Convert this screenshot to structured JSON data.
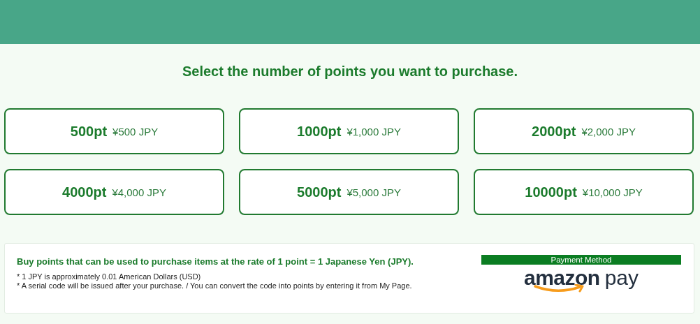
{
  "heading": "Select the number of points you want to purchase.",
  "options": [
    {
      "points": "500pt",
      "price": "¥500 JPY"
    },
    {
      "points": "1000pt",
      "price": "¥1,000 JPY"
    },
    {
      "points": "2000pt",
      "price": "¥2,000 JPY"
    },
    {
      "points": "4000pt",
      "price": "¥4,000 JPY"
    },
    {
      "points": "5000pt",
      "price": "¥5,000 JPY"
    },
    {
      "points": "10000pt",
      "price": "¥10,000 JPY"
    }
  ],
  "info": {
    "title": "Buy points that can be used to purchase items at the rate of 1 point = 1 Japanese Yen (JPY).",
    "notes": [
      "* 1 JPY is approximately 0.01 American Dollars (USD)",
      "* A serial code will be issued after your purchase. / You can convert the code into points by entering it from My Page."
    ]
  },
  "payment": {
    "label": "Payment Method",
    "logo_word": "amazon",
    "logo_suffix": "pay"
  }
}
